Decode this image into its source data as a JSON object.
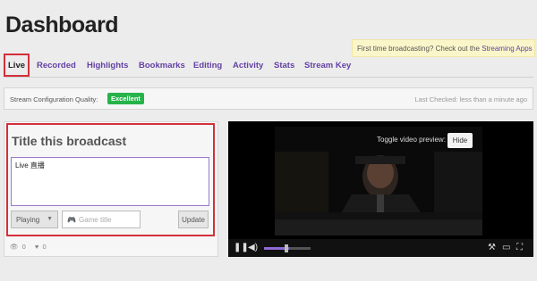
{
  "page": {
    "title": "Dashboard"
  },
  "notice": {
    "text": "First time broadcasting? Check out the ",
    "link": "Streaming Apps"
  },
  "tabs": [
    {
      "label": "Live",
      "active": true
    },
    {
      "label": "Recorded"
    },
    {
      "label": "Highlights"
    },
    {
      "label": "Bookmarks"
    },
    {
      "label": "Editing"
    },
    {
      "label": "Activity"
    },
    {
      "label": "Stats"
    },
    {
      "label": "Stream Key"
    }
  ],
  "quality": {
    "label": "Stream Configuration Quality:",
    "badge": "Excellent",
    "last_checked": "Last Checked: less than a minute ago"
  },
  "broadcast": {
    "heading": "Title this broadcast",
    "title_value": "Live 直播",
    "playing_label": "Playing",
    "game_placeholder": "Game title",
    "update_label": "Update"
  },
  "stats": {
    "viewers": "0",
    "followers": "0"
  },
  "video": {
    "toggle_label": "Toggle video preview:",
    "hide_label": "Hide"
  },
  "colors": {
    "accent": "#6441a4",
    "highlight_border": "#d32f3a",
    "excellent": "#27b34a"
  }
}
